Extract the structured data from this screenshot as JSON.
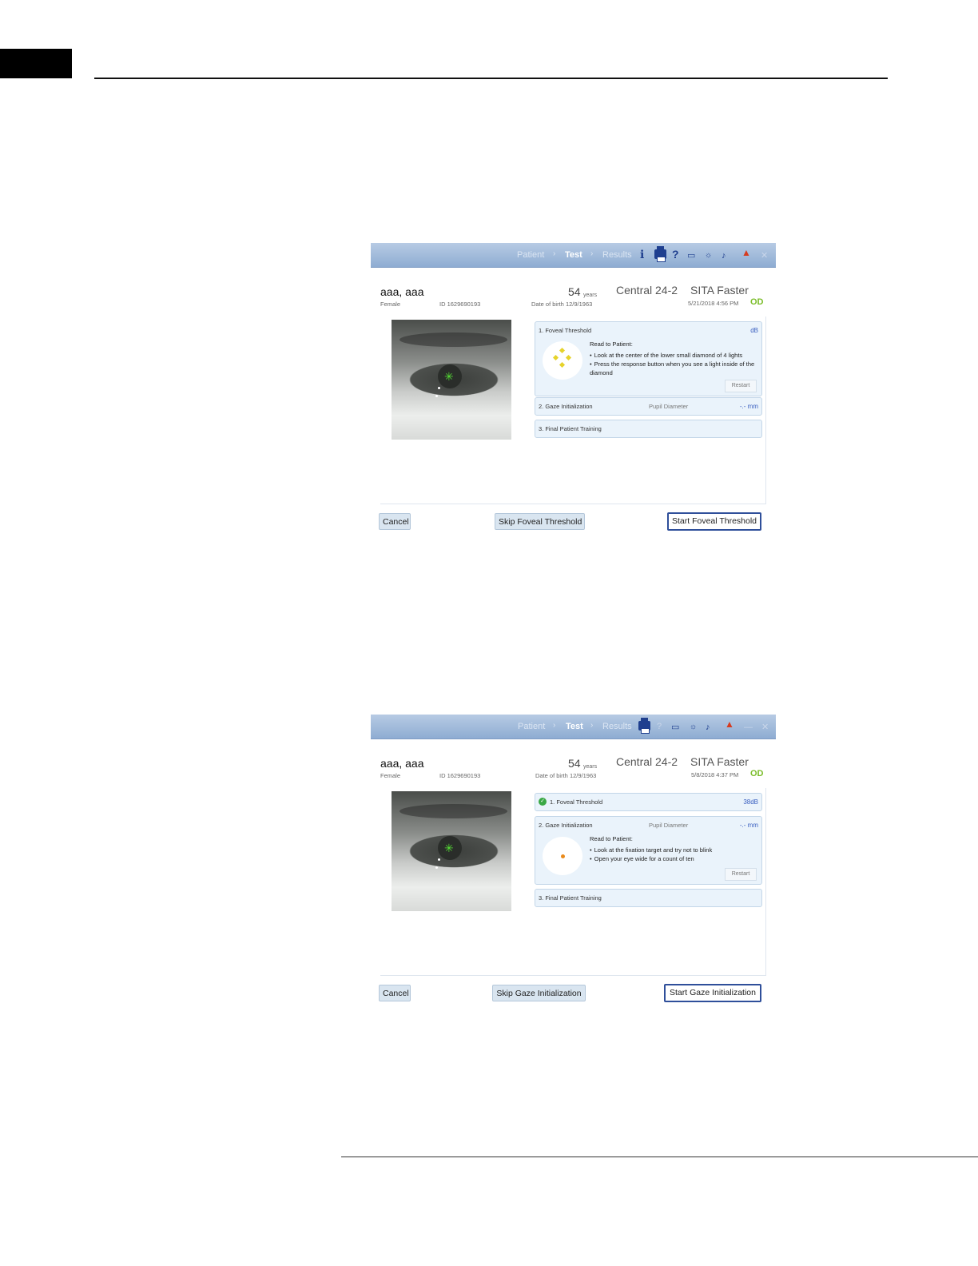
{
  "screens": [
    {
      "nav": {
        "patient": "Patient",
        "test": "Test",
        "results": "Results"
      },
      "patient": {
        "name": "aaa, aaa",
        "sex": "Female",
        "id": "ID 1629690193",
        "age": "54",
        "age_unit": "years",
        "dob": "Date of birth   12/9/1963",
        "test": "Central 24-2",
        "strategy": "SITA Faster",
        "datetime": "5/21/2018 4:56 PM",
        "eye": "OD"
      },
      "steps": {
        "step1": {
          "title": "1. Foveal Threshold",
          "unit": "dB",
          "read_label": "Read to Patient:",
          "instructions": [
            "Look at the center of the lower small diamond of 4 lights",
            "Press the response button when you see a light inside of the diamond"
          ],
          "restart": "Restart"
        },
        "step2": {
          "title": "2. Gaze Initialization",
          "mid": "Pupil Diameter",
          "unit": "-.- mm"
        },
        "step3": {
          "title": "3. Final Patient Training"
        }
      },
      "buttons": {
        "cancel": "Cancel",
        "skip": "Skip Foveal Threshold",
        "start": "Start Foveal Threshold"
      }
    },
    {
      "nav": {
        "patient": "Patient",
        "test": "Test",
        "results": "Results"
      },
      "patient": {
        "name": "aaa, aaa",
        "sex": "Female",
        "id": "ID 1629690193",
        "age": "54",
        "age_unit": "years",
        "dob": "Date of birth   12/9/1963",
        "test": "Central 24-2",
        "strategy": "SITA Faster",
        "datetime": "5/8/2018 4:37 PM",
        "eye": "OD"
      },
      "steps": {
        "step1": {
          "title": "1. Foveal Threshold",
          "unit": "38dB"
        },
        "step2": {
          "title": "2. Gaze Initialization",
          "mid": "Pupil Diameter",
          "unit": "-.- mm",
          "read_label": "Read to Patient:",
          "instructions": [
            "Look at the fixation target and try not to blink",
            "Open your eye wide for a count of ten"
          ],
          "restart": "Restart"
        },
        "step3": {
          "title": "3. Final Patient Training"
        }
      },
      "buttons": {
        "cancel": "Cancel",
        "skip": "Skip Gaze Initialization",
        "start": "Start Gaze Initialization"
      }
    }
  ]
}
